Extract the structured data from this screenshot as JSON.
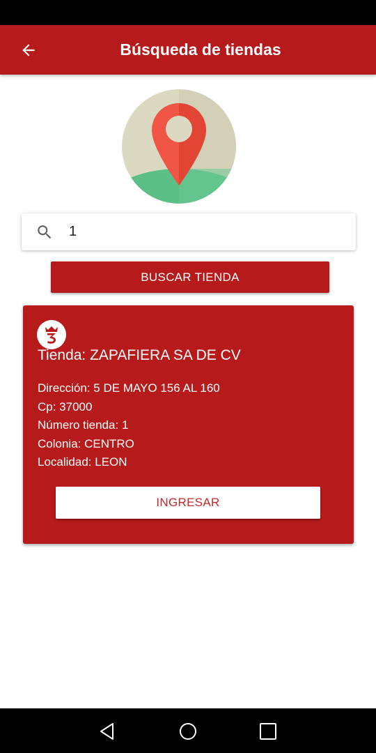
{
  "app_bar": {
    "title": "Búsqueda de tiendas",
    "back_icon": "arrow-left-icon"
  },
  "hero": {
    "icon": "location-pin-icon"
  },
  "search": {
    "icon": "search-icon",
    "value": "1"
  },
  "search_button": {
    "label": "BUSCAR TIENDA"
  },
  "store_card": {
    "logo_icon": "store-brand-logo",
    "name": "Tienda: ZAPAFIERA SA DE CV",
    "details": [
      "Dirección: 5 DE MAYO 156 AL 160",
      "Cp: 37000",
      "Número tienda: 1",
      "Colonia: CENTRO",
      "Localidad: LEON"
    ],
    "enter_label": "INGRESAR"
  },
  "nav_bar": {
    "back_icon": "triangle-back-icon",
    "home_icon": "circle-home-icon",
    "recents_icon": "square-recents-icon"
  },
  "colors": {
    "primary_red": "#b71a1a",
    "button_text_red": "#c62828",
    "pin_red": "#f05545",
    "ground_green": "#5bbf86",
    "sky_beige": "#dcd9c3"
  }
}
